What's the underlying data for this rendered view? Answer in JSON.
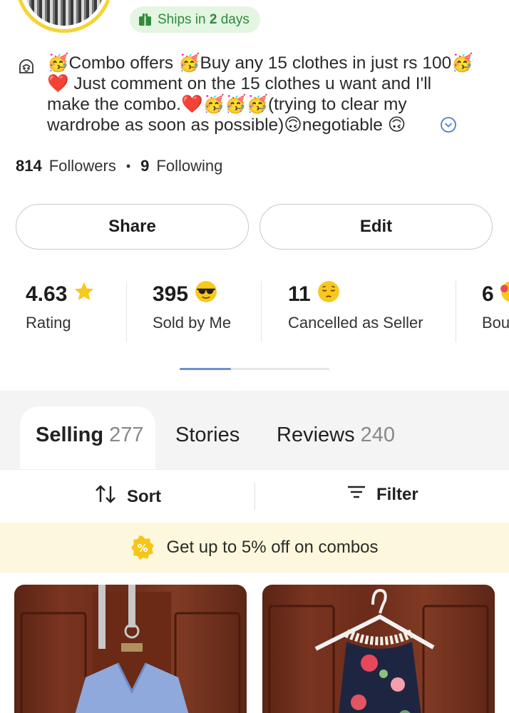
{
  "shipping": {
    "prefix": "Ships in ",
    "days": "2",
    "suffix": " days"
  },
  "bio": {
    "line1_a": "Combo offers ",
    "line1_b": "Buy any 15 clothes in just rs 100",
    "line2": " Just comment on the 15 clothes u want and I'll",
    "line3_a": "make the combo.",
    "line3_b": "(trying to clear  my",
    "line4_a": "wardrobe as soon as possible)",
    "line4_b": "negotiable "
  },
  "follow": {
    "followers_count": "814",
    "followers_label": "Followers",
    "following_count": "9",
    "following_label": "Following"
  },
  "actions": {
    "share_label": "Share",
    "edit_label": "Edit"
  },
  "stats": [
    {
      "value": "4.63",
      "label": "Rating",
      "icon": "star-icon"
    },
    {
      "value": "395",
      "label": "Sold by Me",
      "icon": "sunglasses-emoji-icon"
    },
    {
      "value": "11",
      "label": "Cancelled as Seller",
      "icon": "pensive-emoji-icon"
    },
    {
      "value": "6",
      "label": "Bou",
      "icon": "emoji-icon"
    }
  ],
  "tabs": [
    {
      "label": "Selling",
      "count": "277"
    },
    {
      "label": "Stories",
      "count": ""
    },
    {
      "label": "Reviews",
      "count": "240"
    }
  ],
  "toolbar": {
    "sort_label": "Sort",
    "filter_label": "Filter"
  },
  "banner": {
    "text": "Get up to 5% off on combos"
  },
  "colors": {
    "accent_green": "#3cbe57",
    "ring_yellow": "#f7d233",
    "banner_bg": "#fdf8dd",
    "scroll_thumb": "#6b8fd0"
  }
}
